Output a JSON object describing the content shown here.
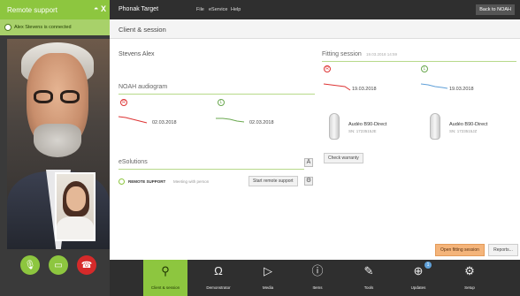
{
  "remote_panel": {
    "title": "Remote support",
    "status": "Alex Stevens is connected",
    "controls": "◓ X"
  },
  "topbar": {
    "app_title": "Phonak Target",
    "menu": [
      "File",
      "eService",
      "Help"
    ],
    "back_button": "Back to NOAH"
  },
  "page": {
    "title": "Client & session"
  },
  "client": {
    "name": "Stevens Alex"
  },
  "noah": {
    "title": "NOAH audiogram",
    "right_date": "02.03.2018",
    "left_date": "02.03.2018"
  },
  "fitting": {
    "title": "Fitting session",
    "timestamp": "19.03.2018 14:59",
    "right_date": "19.03.2018",
    "left_date": "19.03.2018",
    "devices": [
      {
        "name": "Audéo B90-Direct",
        "serial": "SN: 1723515JE"
      },
      {
        "name": "Audéo B90-Direct",
        "serial": "SN: 1723515JZ"
      }
    ],
    "check_warranty": "Check warranty"
  },
  "esolutions": {
    "title": "eSolutions",
    "row_label": "REMOTE SUPPORT",
    "row_sub": "Meeting with person",
    "start_button": "Start remote support"
  },
  "actions": {
    "open": "Open fitting session",
    "reports": "Reports..."
  },
  "nav": [
    {
      "label": "Client & session",
      "icon": "person-icon",
      "active": true
    },
    {
      "label": "Demonstrator",
      "icon": "headphones-icon"
    },
    {
      "label": "Media",
      "icon": "play-icon"
    },
    {
      "label": "Items",
      "icon": "info-icon"
    },
    {
      "label": "Tools",
      "icon": "tools-icon"
    },
    {
      "label": "Updates",
      "icon": "download-icon",
      "badge": "1"
    },
    {
      "label": "Setup",
      "icon": "gear-icon"
    }
  ],
  "colors": {
    "accent": "#8dc63f",
    "hangup": "#d62a2a",
    "open_button": "#f4b47a"
  }
}
